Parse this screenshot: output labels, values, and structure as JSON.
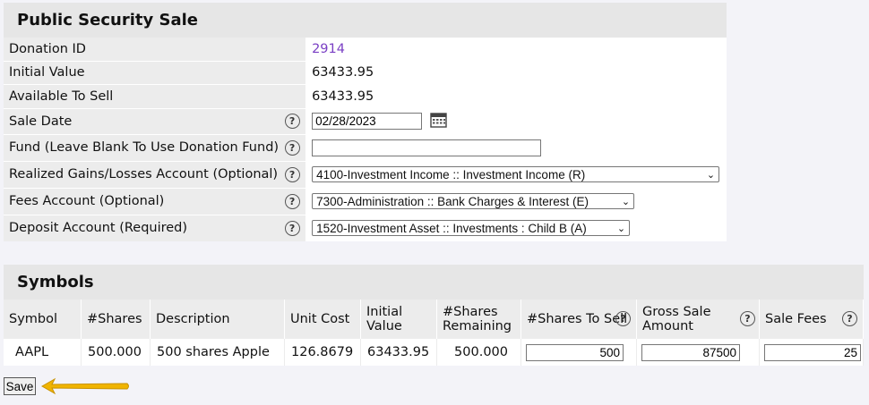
{
  "sale": {
    "title": "Public Security Sale",
    "donation_id_label": "Donation ID",
    "donation_id": "2914",
    "initial_value_label": "Initial Value",
    "initial_value": "63433.95",
    "available_label": "Available To Sell",
    "available": "63433.95",
    "sale_date_label": "Sale Date",
    "sale_date": "02/28/2023",
    "fund_label": "Fund (Leave Blank To Use Donation Fund)",
    "fund": "",
    "gains_label": "Realized Gains/Losses Account (Optional)",
    "gains_value": "4100-Investment Income :: Investment Income (R)",
    "fees_label": "Fees Account (Optional)",
    "fees_value": "7300-Administration :: Bank Charges & Interest (E)",
    "deposit_label": "Deposit Account (Required)",
    "deposit_value": "1520-Investment Asset :: Investments : Child B (A)",
    "help_glyph": "?"
  },
  "symbols": {
    "title": "Symbols",
    "headers": {
      "symbol": "Symbol",
      "shares": "#Shares",
      "description": "Description",
      "unit_cost": "Unit Cost",
      "initial_value_1": "Initial",
      "initial_value_2": "Value",
      "remaining_1": "#Shares",
      "remaining_2": "Remaining",
      "to_sell": "#Shares To Sell",
      "gross_1": "Gross Sale",
      "gross_2": "Amount",
      "fees": "Sale Fees"
    },
    "row": {
      "symbol": "AAPL",
      "shares": "500.000",
      "description": "500 shares Apple",
      "unit_cost": "126.8679",
      "initial_value": "63433.95",
      "remaining": "500.000",
      "to_sell": "500",
      "gross": "87500",
      "fees": "25"
    }
  },
  "actions": {
    "save_label": "Save"
  },
  "colors": {
    "link": "#7a3fc4",
    "arrow": "#f0b400"
  }
}
